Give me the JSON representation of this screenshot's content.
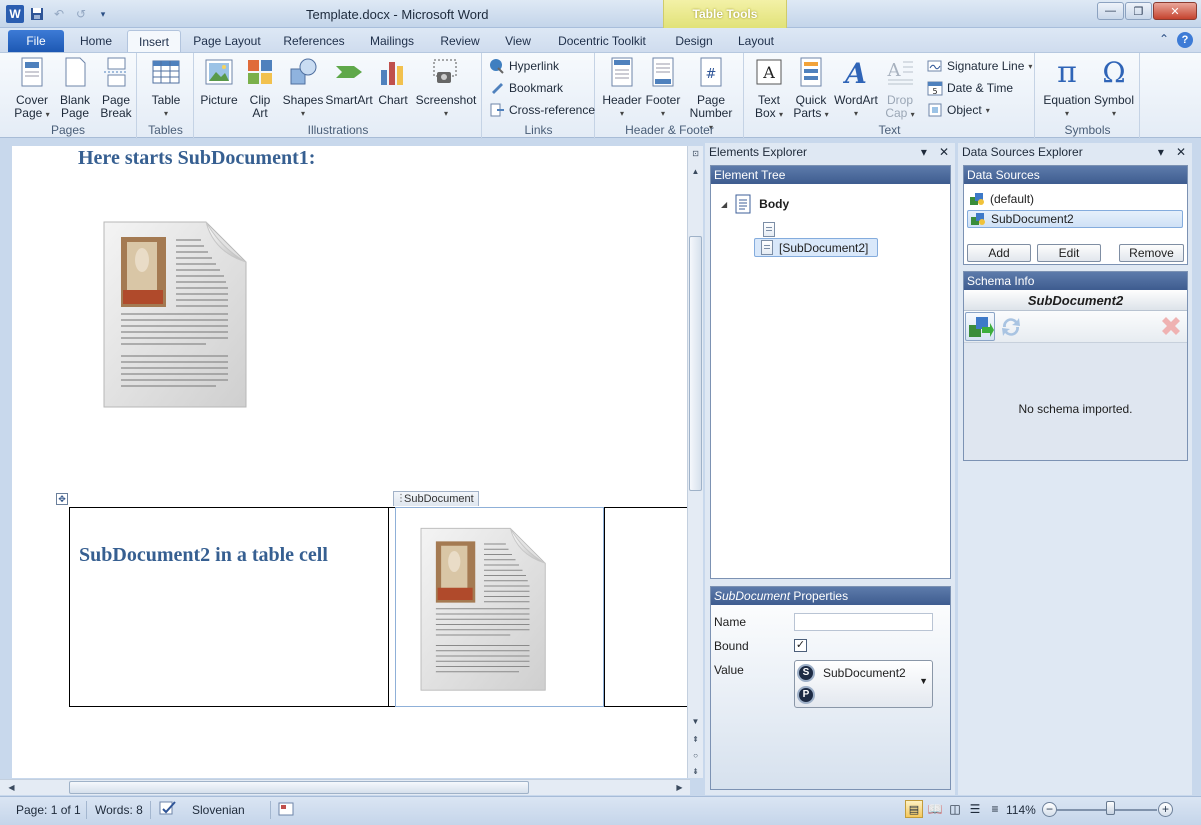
{
  "window": {
    "title": "Template.docx - Microsoft Word",
    "context_tab_group": "Table Tools"
  },
  "tabs": [
    "File",
    "Home",
    "Insert",
    "Page Layout",
    "References",
    "Mailings",
    "Review",
    "View",
    "Docentric Toolkit",
    "Design",
    "Layout"
  ],
  "ribbon": {
    "pages": {
      "label": "Pages",
      "cover_page": [
        "Cover",
        "Page"
      ],
      "blank_page": [
        "Blank",
        "Page"
      ],
      "page_break": [
        "Page",
        "Break"
      ]
    },
    "tables": {
      "label": "Tables",
      "table": "Table"
    },
    "illustrations": {
      "label": "Illustrations",
      "picture": "Picture",
      "clip_art": [
        "Clip",
        "Art"
      ],
      "shapes": "Shapes",
      "smartart": "SmartArt",
      "chart": "Chart",
      "screenshot": "Screenshot"
    },
    "links": {
      "label": "Links",
      "hyperlink": "Hyperlink",
      "bookmark": "Bookmark",
      "cross_reference": "Cross-reference"
    },
    "header_footer": {
      "label": "Header & Footer",
      "header": "Header",
      "footer": "Footer",
      "page_number": [
        "Page",
        "Number"
      ]
    },
    "text": {
      "label": "Text",
      "text_box": [
        "Text",
        "Box"
      ],
      "quick_parts": [
        "Quick",
        "Parts"
      ],
      "wordart": "WordArt",
      "drop_cap": [
        "Drop",
        "Cap"
      ],
      "signature_line": "Signature Line",
      "date_time": "Date & Time",
      "object": "Object"
    },
    "symbols": {
      "label": "Symbols",
      "equation": "Equation",
      "symbol": "Symbol"
    }
  },
  "document": {
    "heading1": "Here starts SubDocument1:",
    "cell_text": "SubDocument2 in a table cell",
    "content_control_tag": "SubDocument"
  },
  "elements_explorer": {
    "title": "Elements Explorer",
    "tree_header": "Element Tree",
    "body_node": "Body",
    "subdoc_node": "[SubDocument2]",
    "properties_header_italic": "SubDocument",
    "properties_header_rest": " Properties",
    "name_label": "Name",
    "name_value": "",
    "bound_label": "Bound",
    "bound_checked": true,
    "value_label": "Value",
    "value_s": "SubDocument2",
    "value_p": ""
  },
  "data_sources_explorer": {
    "title": "Data Sources Explorer",
    "sources_header": "Data Sources",
    "items": [
      "(default)",
      "SubDocument2"
    ],
    "selected_index": 1,
    "add_label": "Add",
    "edit_label": "Edit",
    "remove_label": "Remove",
    "schema_header": "Schema Info",
    "schema_name": "SubDocument2",
    "no_schema": "No schema imported."
  },
  "status": {
    "page": "Page: 1 of 1",
    "words": "Words: 8",
    "language": "Slovenian",
    "zoom": "114%",
    "zoom_percent": 114
  },
  "colors": {
    "heading": "#365f91",
    "accent": "#3e5c8f",
    "file_tab": "#2a64c4",
    "context": "#e1e278"
  }
}
